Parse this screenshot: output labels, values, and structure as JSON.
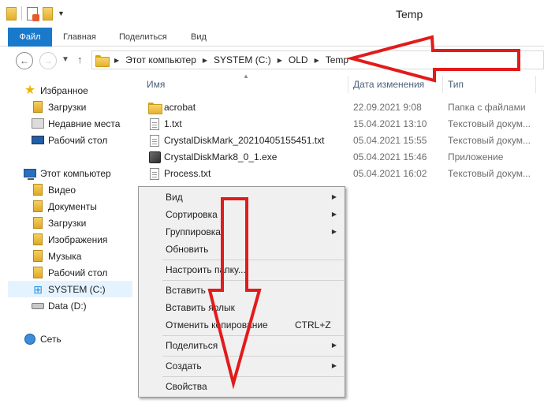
{
  "window": {
    "title": "Temp"
  },
  "ribbon": {
    "file_tab": "Файл",
    "tabs": [
      "Главная",
      "Поделиться",
      "Вид"
    ]
  },
  "address": {
    "crumbs": [
      "Этот компьютер",
      "SYSTEM (C:)",
      "OLD",
      "Temp"
    ]
  },
  "navpane": {
    "favorites": {
      "label": "Избранное",
      "items": [
        "Загрузки",
        "Недавние места",
        "Рабочий стол"
      ]
    },
    "computer": {
      "label": "Этот компьютер",
      "items": [
        "Видео",
        "Документы",
        "Загрузки",
        "Изображения",
        "Музыка",
        "Рабочий стол",
        "SYSTEM (C:)",
        "Data (D:)"
      ]
    },
    "network": {
      "label": "Сеть"
    }
  },
  "columns": {
    "name": "Имя",
    "date": "Дата изменения",
    "type": "Тип"
  },
  "files": [
    {
      "name": "acrobat",
      "date": "22.09.2021 9:08",
      "type": "Папка с файлами",
      "icon": "folder-icon"
    },
    {
      "name": "1.txt",
      "date": "15.04.2021 13:10",
      "type": "Текстовый докум...",
      "icon": "text-file-icon"
    },
    {
      "name": "CrystalDiskMark_20210405155451.txt",
      "date": "05.04.2021 15:55",
      "type": "Текстовый докум...",
      "icon": "text-file-icon"
    },
    {
      "name": "CrystalDiskMark8_0_1.exe",
      "date": "05.04.2021 15:46",
      "type": "Приложение",
      "icon": "app-icon"
    },
    {
      "name": "Process.txt",
      "date": "05.04.2021 16:02",
      "type": "Текстовый докум...",
      "icon": "text-file-icon"
    }
  ],
  "context_menu": {
    "view": "Вид",
    "sort": "Сортировка",
    "group": "Группировка",
    "refresh": "Обновить",
    "customize": "Настроить папку...",
    "paste": "Вставить",
    "paste_shortcut": "Вставить ярлык",
    "undo_copy": "Отменить копирование",
    "undo_shortcut": "CTRL+Z",
    "share": "Поделиться",
    "new": "Создать",
    "properties": "Свойства"
  },
  "colors": {
    "accent": "#1979ca",
    "annotation": "#e21b1b"
  }
}
